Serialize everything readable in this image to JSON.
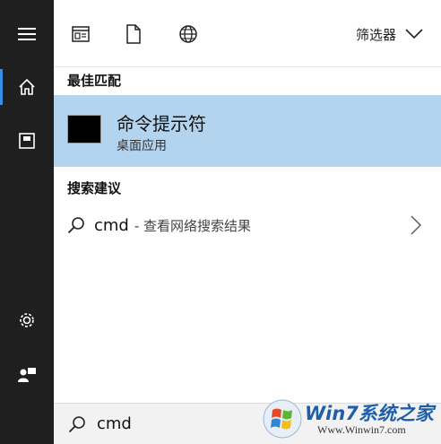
{
  "rail": {
    "items": [
      {
        "icon": "hamburger-menu-icon"
      },
      {
        "icon": "home-icon",
        "active": true
      },
      {
        "icon": "documents-icon"
      },
      {
        "icon": "settings-gear-icon"
      },
      {
        "icon": "user-feedback-icon"
      }
    ],
    "accent": "#3a8ee6",
    "background": "#1f1f1f"
  },
  "topbar": {
    "icons": [
      "apps-icon",
      "document-icon",
      "web-globe-icon"
    ],
    "filter_label": "筛选器"
  },
  "best_match": {
    "section_title": "最佳匹配",
    "app_name": "命令提示符",
    "app_type": "桌面应用",
    "highlight_color": "#b3d4ee"
  },
  "suggestions": {
    "section_title": "搜索建议",
    "items": [
      {
        "query": "cmd",
        "suffix": "- 查看网络搜索结果"
      }
    ]
  },
  "search": {
    "value": "cmd"
  },
  "watermark": {
    "brand": "Win7系统之家",
    "url": "Www.Winwin7.com"
  }
}
